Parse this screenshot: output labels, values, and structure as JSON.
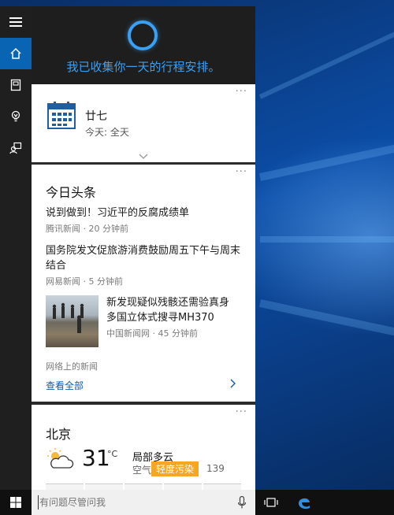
{
  "cortana": {
    "greeting": "我已收集你一天的行程安排。"
  },
  "calendar_card": {
    "day": "廿七",
    "subtitle": "今天: 全天",
    "more": "···"
  },
  "news_card": {
    "heading": "今日头条",
    "more": "···",
    "items": [
      {
        "title": "说到做到！习近平的反腐成绩单",
        "meta": "腾讯新闻 · 20 分钟前"
      },
      {
        "title": "国务院发文促旅游消费鼓励周五下午与周末结合",
        "meta": "网易新闻 · 5 分钟前"
      },
      {
        "title": "新发现疑似残骸还需验真身 多国立体式搜寻MH370",
        "meta": "中国新闻网 · 45 分钟前"
      }
    ],
    "source": "网络上的新闻",
    "see_all": "查看全部"
  },
  "weather_card": {
    "city": "北京",
    "more": "···",
    "temp": "31",
    "unit": "°C",
    "condition": "局部多云",
    "air_label": "空气",
    "air_quality": "轻度污染",
    "aqi": "139"
  },
  "search": {
    "placeholder": "有问题尽管问我"
  },
  "colors": {
    "accent": "#3aa0f3",
    "air_badge": "#f5a623"
  },
  "icons": [
    "hamburger-icon",
    "home-icon",
    "notebook-icon",
    "bulb-icon",
    "feedback-icon",
    "calendar-icon",
    "chevron-right-icon",
    "partly-cloudy-icon",
    "windows-icon",
    "mic-icon",
    "task-view-icon",
    "edge-icon"
  ]
}
